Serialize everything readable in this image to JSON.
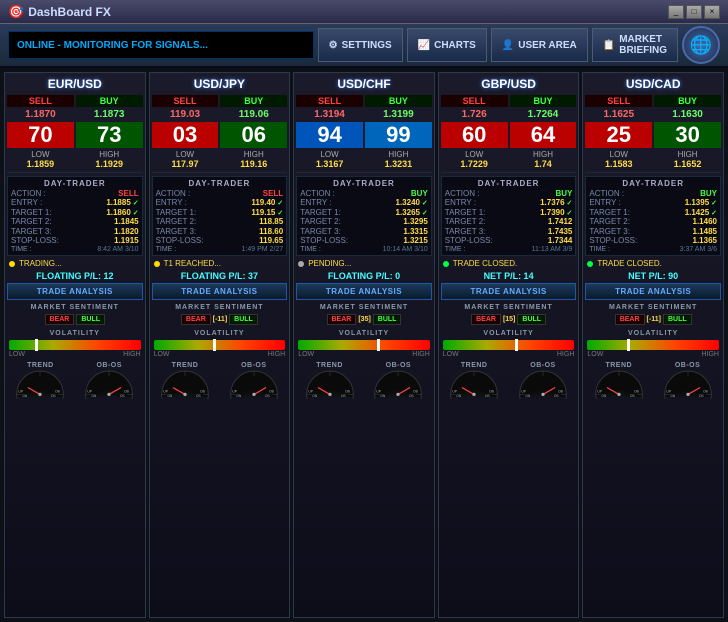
{
  "titleBar": {
    "title": "DashBoard FX",
    "icon": "⬛",
    "buttons": [
      "_",
      "□",
      "×"
    ]
  },
  "nav": {
    "status": "ONLINE - MONITORING FOR SIGNALS...",
    "buttons": [
      {
        "label": "SETTINGS",
        "icon": "⚙"
      },
      {
        "label": "CHARTS",
        "icon": "📈"
      },
      {
        "label": "USER AREA",
        "icon": "👤"
      },
      {
        "label": "MARKET\nBRIEFING",
        "icon": "📋"
      }
    ]
  },
  "panels": [
    {
      "id": "eurusd",
      "pair": "EUR/USD",
      "sell": "1.1870",
      "buy": "1.1873",
      "bigSell": "70",
      "bigBuy": "73",
      "lowLabel": "LOW",
      "highLabel": "HIGH",
      "low": "1.1859",
      "high": "1.1929",
      "action": "SELL",
      "actionClass": "sell",
      "entry": "1.1885",
      "t1": "1.1860",
      "t2": "1.1845",
      "t3": "1.1820",
      "stopLoss": "1.1915",
      "time": "8:42 AM 3/10",
      "statusDot": "yellow",
      "statusText": "TRADING...",
      "floating": "FLOATING P/L: 12",
      "sentiment": {
        "bear": "BEAR",
        "val": "",
        "bull": "BULL",
        "raw": ""
      },
      "sentimentVal": "",
      "volatilityPos": 20,
      "colorScheme": "red"
    },
    {
      "id": "usdjpy",
      "pair": "USD/JPY",
      "sell": "119.03",
      "buy": "119.06",
      "bigSell": "03",
      "bigBuy": "06",
      "lowLabel": "LOW",
      "highLabel": "HIGH",
      "low": "117.97",
      "high": "119.16",
      "action": "SELL",
      "actionClass": "sell",
      "entry": "119.40",
      "t1": "119.15",
      "t2": "118.85",
      "t3": "118.60",
      "stopLoss": "119.65",
      "time": "1:49 PM 2/27",
      "statusDot": "yellow",
      "statusText": "T1 REACHED...",
      "floating": "FLOATING P/L: 37",
      "sentiment": {
        "bear": "BEAR",
        "val": "-11",
        "bull": "BULL"
      },
      "sentimentVal": "-11",
      "volatilityPos": 45,
      "colorScheme": "red"
    },
    {
      "id": "usdchf",
      "pair": "USD/CHF",
      "sell": "1.3194",
      "buy": "1.3199",
      "bigSell": "94",
      "bigBuy": "99",
      "lowLabel": "LOW",
      "highLabel": "HIGH",
      "low": "1.3167",
      "high": "1.3231",
      "action": "BUY",
      "actionClass": "buy",
      "entry": "1.3240",
      "t1": "1.3265",
      "t2": "1.3295",
      "t3": "1.3315",
      "stopLoss": "1.3215",
      "time": "10:14 AM 3/10",
      "statusDot": "gray",
      "statusText": "PENDING...",
      "floating": "FLOATING P/L: 0",
      "sentiment": {
        "bear": "BEAR",
        "val": "35",
        "bull": "BULL"
      },
      "sentimentVal": "35",
      "volatilityPos": 60,
      "colorScheme": "blue"
    },
    {
      "id": "gbpusd",
      "pair": "GBP/USD",
      "sell": "1.726",
      "buy": "1.7264",
      "bigSell": "60",
      "bigBuy": "64",
      "lowLabel": "LOW",
      "highLabel": "HIGH",
      "low": "1.7229",
      "high": "1.74",
      "action": "BUY",
      "actionClass": "buy",
      "entry": "1.7376",
      "t1": "1.7390",
      "t2": "1.7412",
      "t3": "1.7435",
      "stopLoss": "1.7344",
      "time": "11:13 AM 3/9",
      "statusDot": "green",
      "statusText": "TRADE CLOSED.",
      "floating": "NET P/L: 14",
      "sentiment": {
        "bear": "BEAR",
        "val": "15",
        "bull": "BULL"
      },
      "sentimentVal": "15",
      "volatilityPos": 55,
      "colorScheme": "red"
    },
    {
      "id": "usdcad",
      "pair": "USD/CAD",
      "sell": "1.1625",
      "buy": "1.1630",
      "bigSell": "25",
      "bigBuy": "30",
      "lowLabel": "LOW",
      "highLabel": "HIGH",
      "low": "1.1583",
      "high": "1.1652",
      "action": "BUY",
      "actionClass": "buy",
      "entry": "1.1395",
      "t1": "1.1425",
      "t2": "1.1460",
      "t3": "1.1485",
      "stopLoss": "1.1365",
      "time": "3:37 AM 3/6",
      "statusDot": "green",
      "statusText": "TRADE CLOSED.",
      "floating": "NET P/L: 90",
      "sentiment": {
        "bear": "BEAR",
        "val": "-11",
        "bull": "BULL"
      },
      "sentimentVal": "-11",
      "volatilityPos": 30,
      "colorScheme": "red"
    }
  ],
  "labels": {
    "dayTrader": "DAY-TRADER",
    "action": "ACTION :",
    "entry": "ENTRY :",
    "target1": "TARGET 1:",
    "target2": "TARGET 2:",
    "target3": "TARGET 3:",
    "stopLoss": "STOP-LOSS:",
    "timing": "TIME :",
    "tradeBtn": "TRADE ANALYSIS",
    "marketSentiment": "MARKET SENTIMENT",
    "volatility": "VOLATILITY",
    "trend": "TREND",
    "obos": "OB-OS",
    "low": "LOW",
    "high": "HIGH",
    "bear": "BEAR",
    "bull": "BULL",
    "up": "UP",
    "dn": "DN",
    "ob": "OB",
    "os": "OS"
  }
}
